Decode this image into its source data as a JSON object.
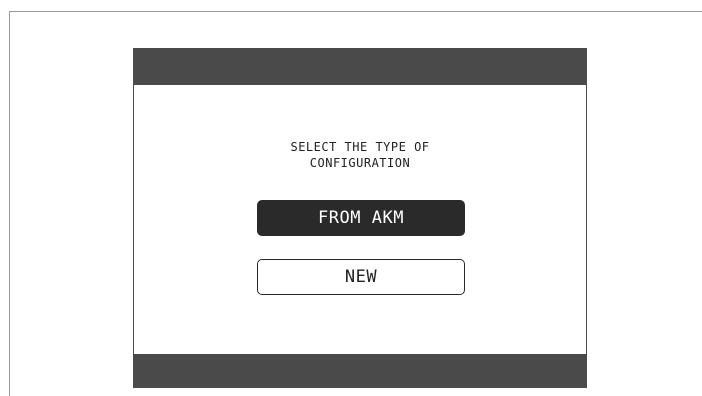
{
  "dialog": {
    "prompt_line1": "SELECT THE TYPE OF",
    "prompt_line2": "CONFIGURATION",
    "options": [
      {
        "label": "FROM AKM",
        "selected": true
      },
      {
        "label": "NEW",
        "selected": false
      }
    ]
  },
  "colors": {
    "bar": "#4a4a4a",
    "selected_bg": "#2a2a2a",
    "selected_text": "#ffffff",
    "text": "#222222",
    "frame": "#9a9a9a"
  }
}
